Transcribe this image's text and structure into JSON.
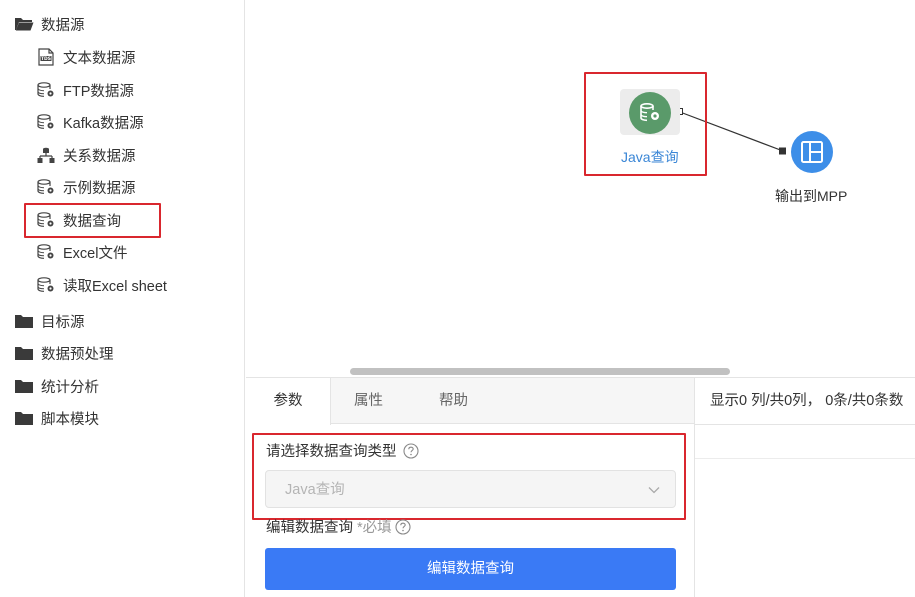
{
  "sidebar": {
    "folders": [
      {
        "label": "数据源",
        "icon": "folder-open-icon"
      },
      {
        "label": "目标源",
        "icon": "folder-icon"
      },
      {
        "label": "数据预处理",
        "icon": "folder-icon"
      },
      {
        "label": "统计分析",
        "icon": "folder-icon"
      },
      {
        "label": "脚本模块",
        "icon": "folder-icon"
      }
    ],
    "items": [
      {
        "label": "文本数据源",
        "icon": "tds-file-icon"
      },
      {
        "label": "FTP数据源",
        "icon": "database-gear-icon"
      },
      {
        "label": "Kafka数据源",
        "icon": "database-gear-icon"
      },
      {
        "label": "关系数据源",
        "icon": "relational-db-icon"
      },
      {
        "label": "示例数据源",
        "icon": "database-gear-icon"
      },
      {
        "label": "数据查询",
        "icon": "database-gear-icon",
        "highlighted": true
      },
      {
        "label": "Excel文件",
        "icon": "database-gear-icon"
      },
      {
        "label": "读取Excel sheet",
        "icon": "database-gear-icon"
      }
    ]
  },
  "canvas": {
    "nodes": [
      {
        "label": "Java查询",
        "icon": "database-gear-icon",
        "color": "#5a9a6a",
        "selected": true
      },
      {
        "label": "输出到MPP",
        "icon": "layout-panels-icon",
        "color": "#3d8ee8"
      }
    ]
  },
  "panel": {
    "tabs": [
      "参数",
      "属性",
      "帮助"
    ],
    "active_tab": "参数",
    "status": "显示0 列/共0列， 0条/共0条数",
    "query_type_label": "请选择数据查询类型",
    "query_type_value": "Java查询",
    "edit_label": "编辑数据查询",
    "required_mark": "*必填",
    "edit_button": "编辑数据查询"
  },
  "colors": {
    "highlight": "#d9272e",
    "primary": "#3a7af5",
    "java_node": "#5a9a6a",
    "mpp_node": "#3d8ee8",
    "node_label_blue": "#3a86d6"
  }
}
